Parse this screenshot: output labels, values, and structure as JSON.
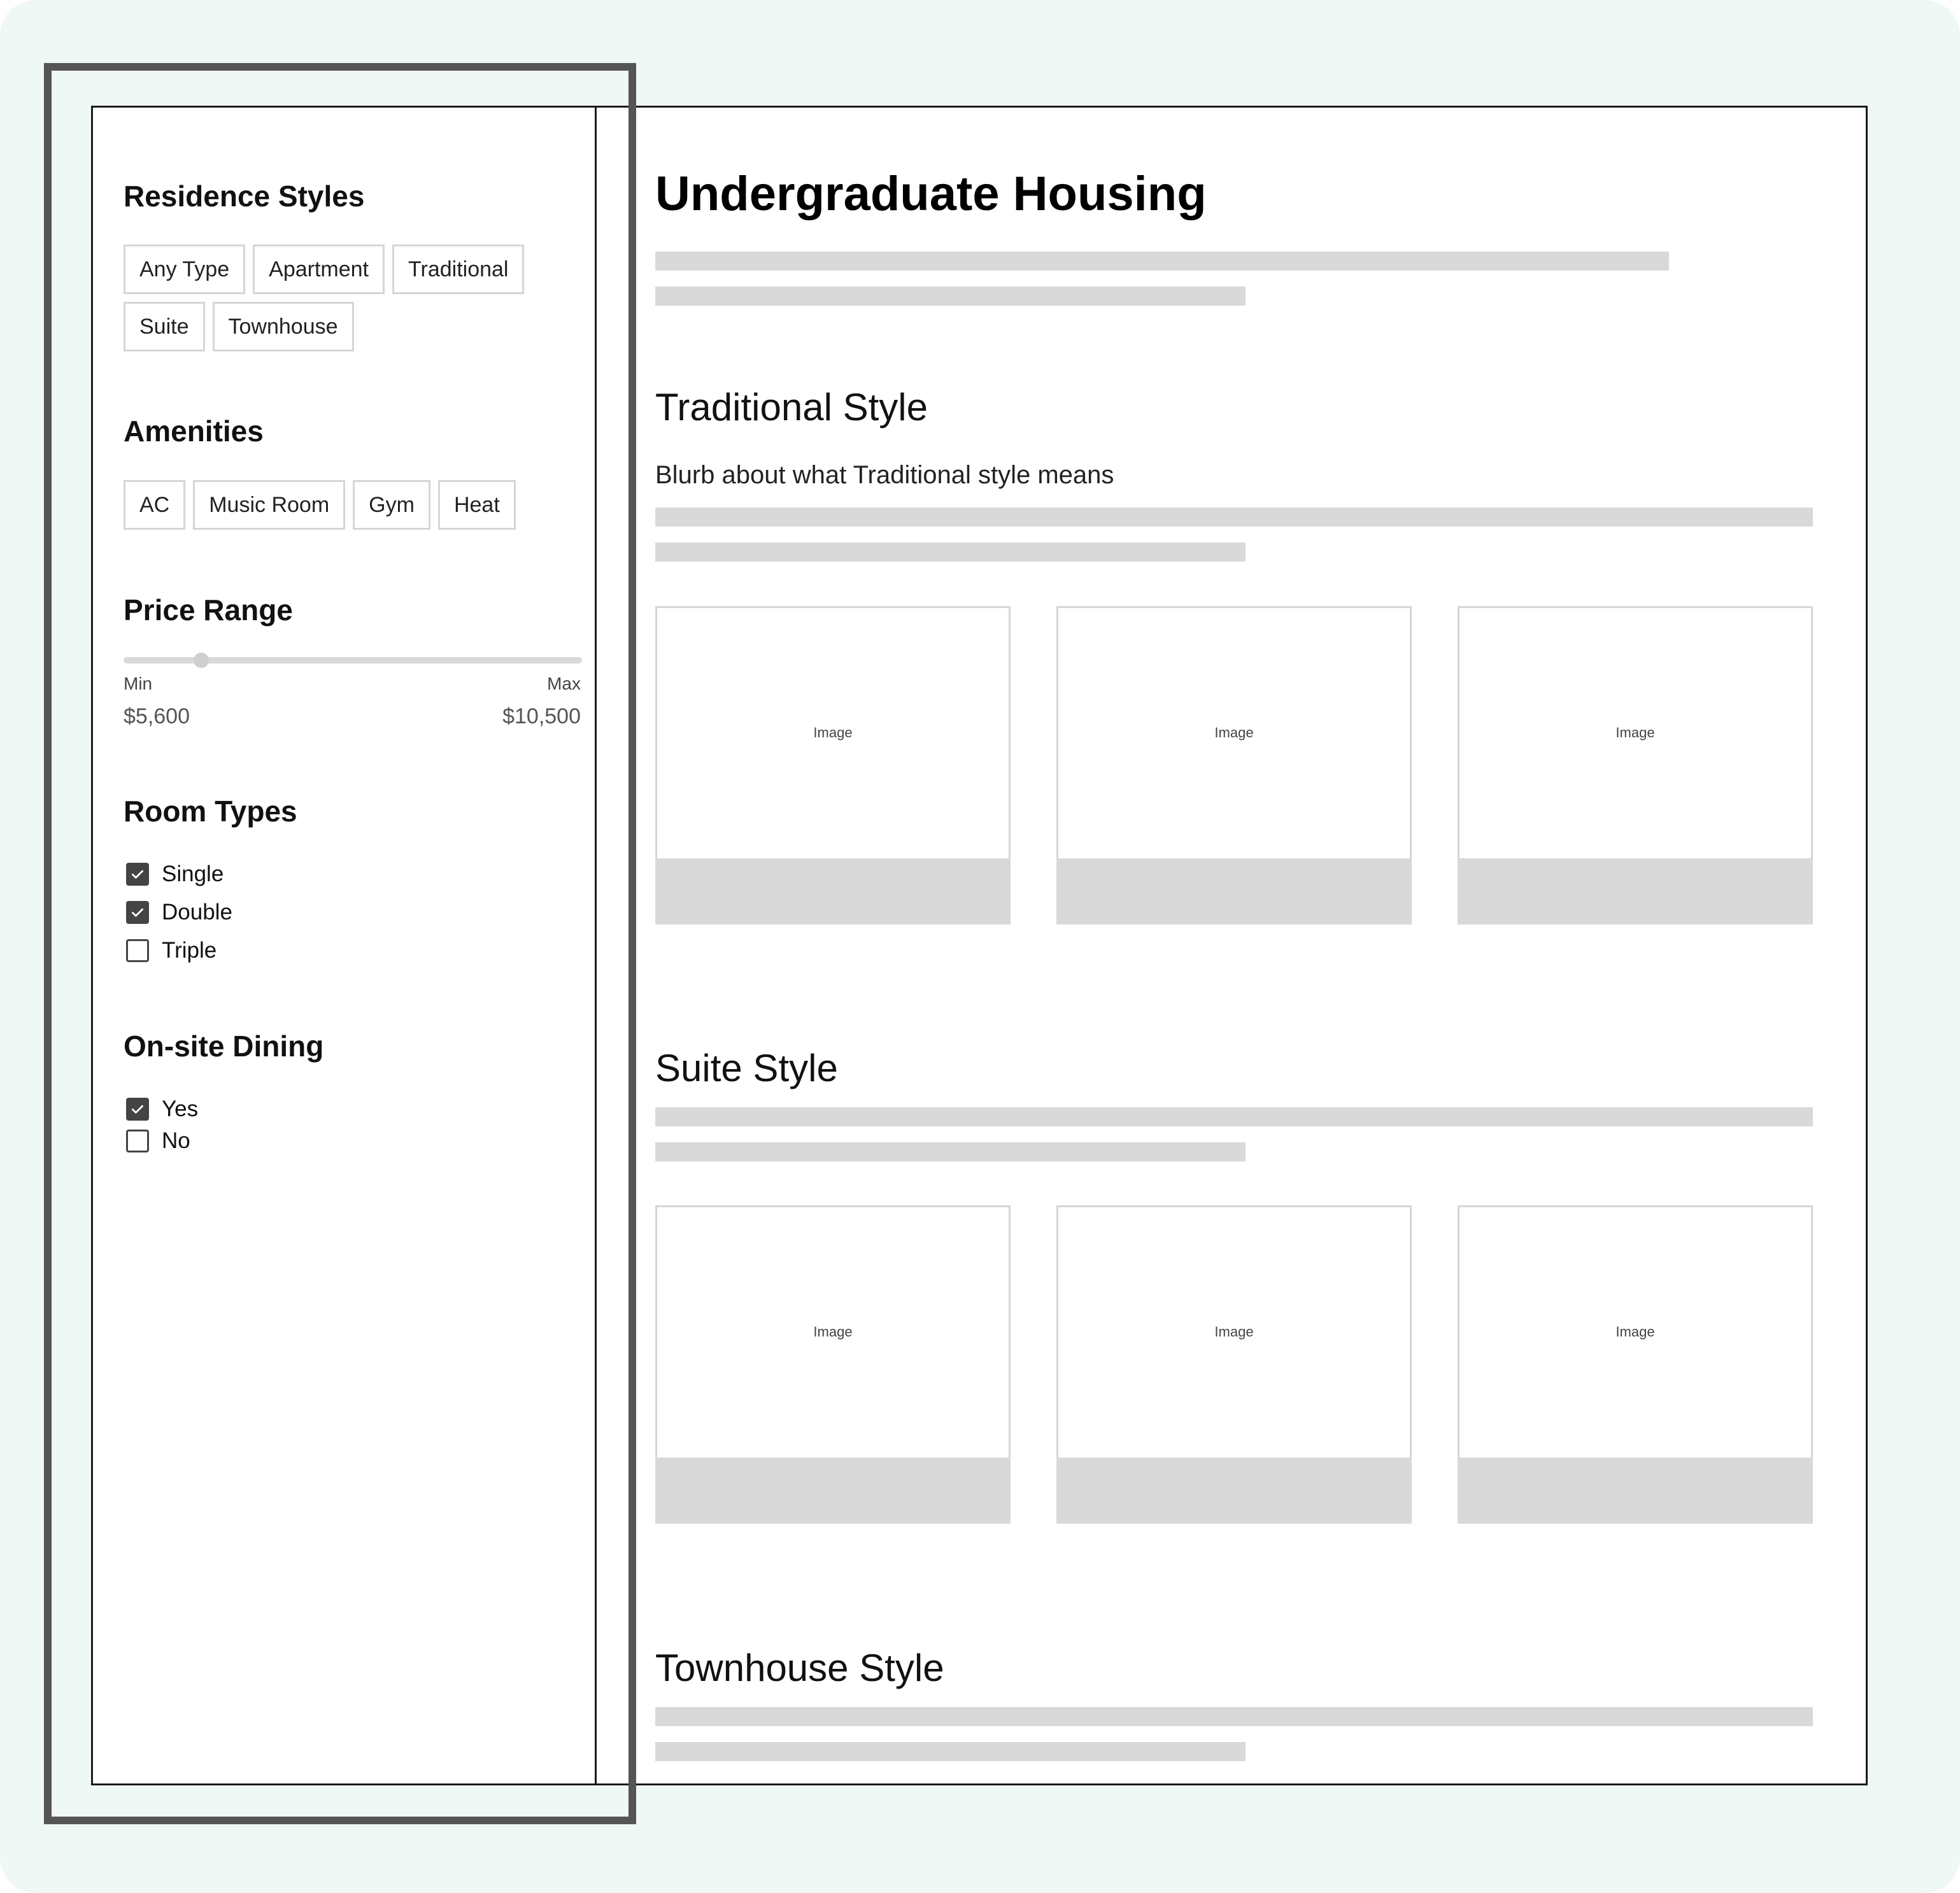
{
  "filters": {
    "residence_styles": {
      "heading": "Residence Styles",
      "chips_row1": [
        "Any Type",
        "Apartment",
        "Traditional"
      ],
      "chips_row2": [
        "Suite",
        "Townhouse"
      ]
    },
    "amenities": {
      "heading": "Amenities",
      "chips": [
        "AC",
        "Music Room",
        "Gym",
        "Heat"
      ]
    },
    "price_range": {
      "heading": "Price Range",
      "min_label": "Min",
      "max_label": "Max",
      "min_value": "$5,600",
      "max_value": "$10,500",
      "slider_fraction": 0.17
    },
    "room_types": {
      "heading": "Room Types",
      "options": [
        {
          "label": "Single",
          "checked": true
        },
        {
          "label": "Double",
          "checked": true
        },
        {
          "label": "Triple",
          "checked": false
        }
      ]
    },
    "dining": {
      "heading": "On-site Dining",
      "options": [
        {
          "label": "Yes",
          "checked": true
        },
        {
          "label": "No",
          "checked": false
        }
      ]
    }
  },
  "main": {
    "title": "Undergraduate Housing",
    "sections": [
      {
        "title": "Traditional Style",
        "blurb": "Blurb about what Traditional style means",
        "image_label": "Image"
      },
      {
        "title": "Suite Style",
        "image_label": "Image"
      },
      {
        "title": "Townhouse Style"
      }
    ]
  },
  "icons": {
    "check": "check-icon"
  },
  "colors": {
    "background": "#f0f8f6",
    "placeholder": "#d9d9d9",
    "highlight": "#555555"
  }
}
